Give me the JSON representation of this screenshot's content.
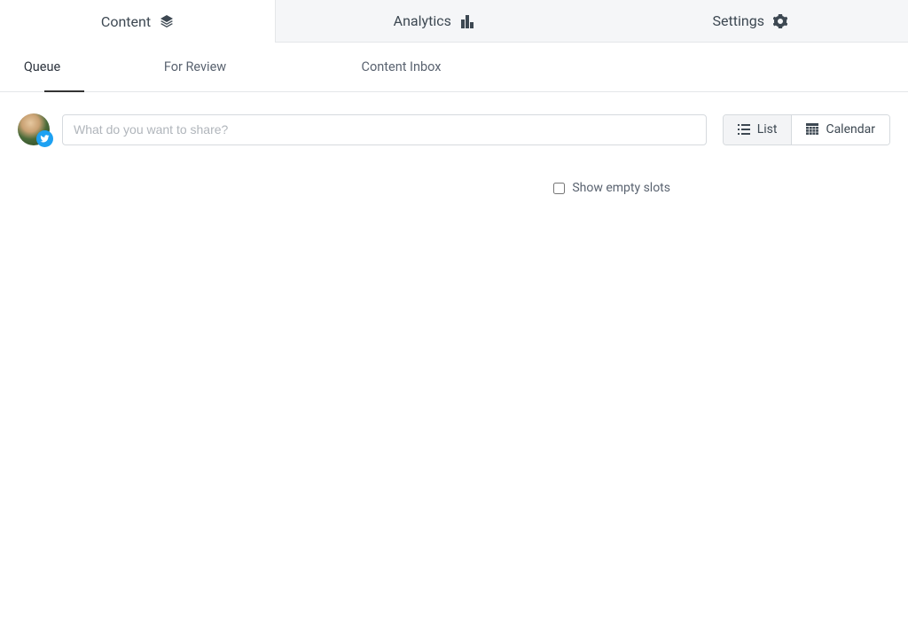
{
  "mainTabs": {
    "content": {
      "label": "Content"
    },
    "analytics": {
      "label": "Analytics"
    },
    "settings": {
      "label": "Settings"
    }
  },
  "subTabs": {
    "queue": {
      "label": "Queue"
    },
    "review": {
      "label": "For Review"
    },
    "inbox": {
      "label": "Content Inbox"
    }
  },
  "composer": {
    "placeholder": "What do you want to share?"
  },
  "viewToggle": {
    "list": {
      "label": "List"
    },
    "calendar": {
      "label": "Calendar"
    }
  },
  "options": {
    "showEmptySlots": {
      "label": "Show empty slots",
      "checked": false
    }
  }
}
